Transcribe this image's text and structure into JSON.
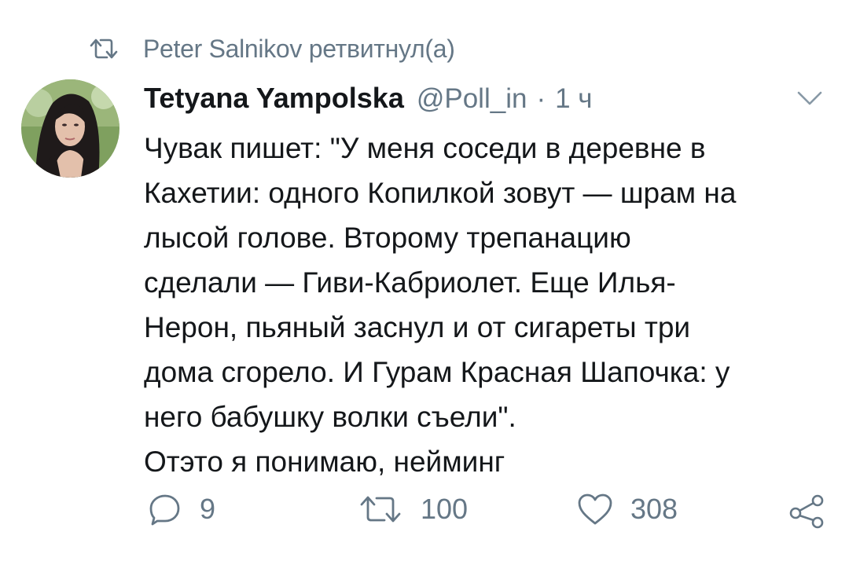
{
  "retweet_banner": {
    "text": "Peter Salnikov ретвитнул(а)",
    "icon": "retweet-icon"
  },
  "tweet": {
    "author_name": "Tetyana Yampolska",
    "author_handle": "@Poll_in",
    "separator": "·",
    "time": "1 ч",
    "avatar": "avatar-photo",
    "menu_icon": "chevron-down-icon",
    "text": "Чувак пишет: \"У меня соседи в деревне в\nКахетии: одного Копилкой зовут — шрам на\nлысой голове. Второму трепанацию\nсделали — Гиви-Кабриолет. Еще Илья-\nНерон, пьяный заснул и от сигареты три\nдома сгорело. И Гурам Красная Шапочка: у\nнего бабушку волки съели\".\nОтэто я понимаю, нейминг"
  },
  "actions": {
    "replies": "9",
    "retweets": "100",
    "likes": "308",
    "icons": [
      "reply-icon",
      "retweet-icon",
      "like-icon",
      "share-icon"
    ]
  },
  "colors": {
    "text": "#14171a",
    "secondary": "#657786",
    "background": "#ffffff"
  }
}
